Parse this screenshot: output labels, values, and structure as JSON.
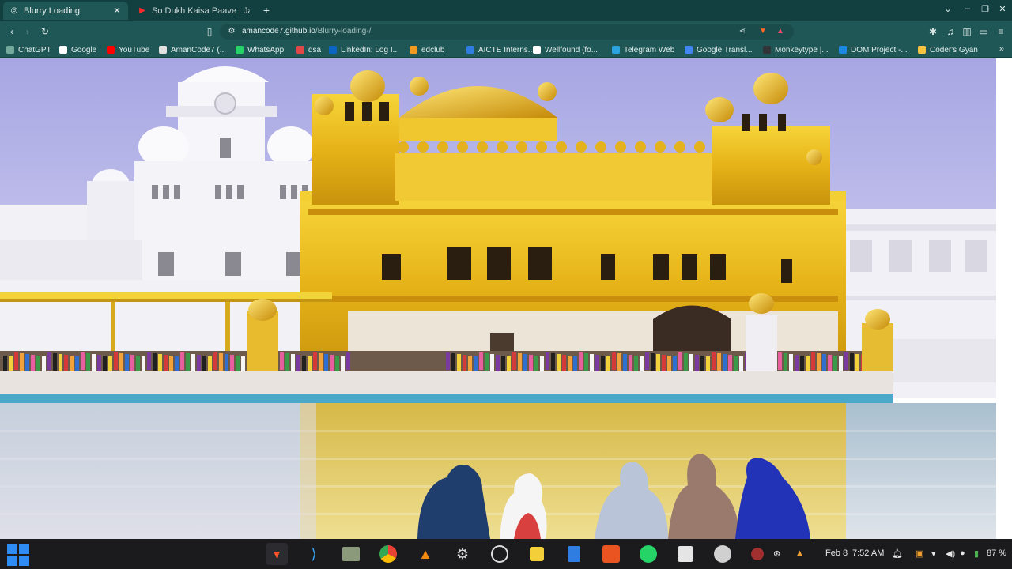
{
  "tabs": [
    {
      "title": "Blurry Loading",
      "icon": "globe-icon",
      "active": true
    },
    {
      "title": "So Dukh Kaisa Paave | Ja...",
      "icon": "youtube-icon",
      "active": false
    }
  ],
  "address": {
    "host": "amancode7.github.io",
    "path": "/Blurry-loading-/"
  },
  "bookmarks": [
    {
      "label": "ChatGPT",
      "color": "#74aa9c"
    },
    {
      "label": "Google",
      "color": "#ffffff"
    },
    {
      "label": "YouTube",
      "color": "#ff0000"
    },
    {
      "label": "AmanCode7 (...",
      "color": "#e0e0e0"
    },
    {
      "label": "WhatsApp",
      "color": "#25d366"
    },
    {
      "label": "dsa",
      "color": "#e04848"
    },
    {
      "label": "LinkedIn: Log I...",
      "color": "#0a66c2"
    },
    {
      "label": "edclub",
      "color": "#f29a1f"
    },
    {
      "label": "AICTE Interns...",
      "color": "#2f7de1"
    },
    {
      "label": "Wellfound (fo...",
      "color": "#ffffff"
    },
    {
      "label": "Telegram Web",
      "color": "#2aa3df"
    },
    {
      "label": "Google Transl...",
      "color": "#4285f4"
    },
    {
      "label": "Monkeytype |...",
      "color": "#323437"
    },
    {
      "label": "DOM Project -...",
      "color": "#1e88e5"
    },
    {
      "label": "Coder's Gyan",
      "color": "#f5c242"
    }
  ],
  "more_bookmarks": "»",
  "taskbar": {
    "date": "Feb 8",
    "time": "7:52 AM",
    "battery": "87 %"
  },
  "colors": {
    "chrome_tabbar": "#123f3f",
    "chrome_toolbar": "#1f5757",
    "taskbar": "#1b1b1d"
  }
}
